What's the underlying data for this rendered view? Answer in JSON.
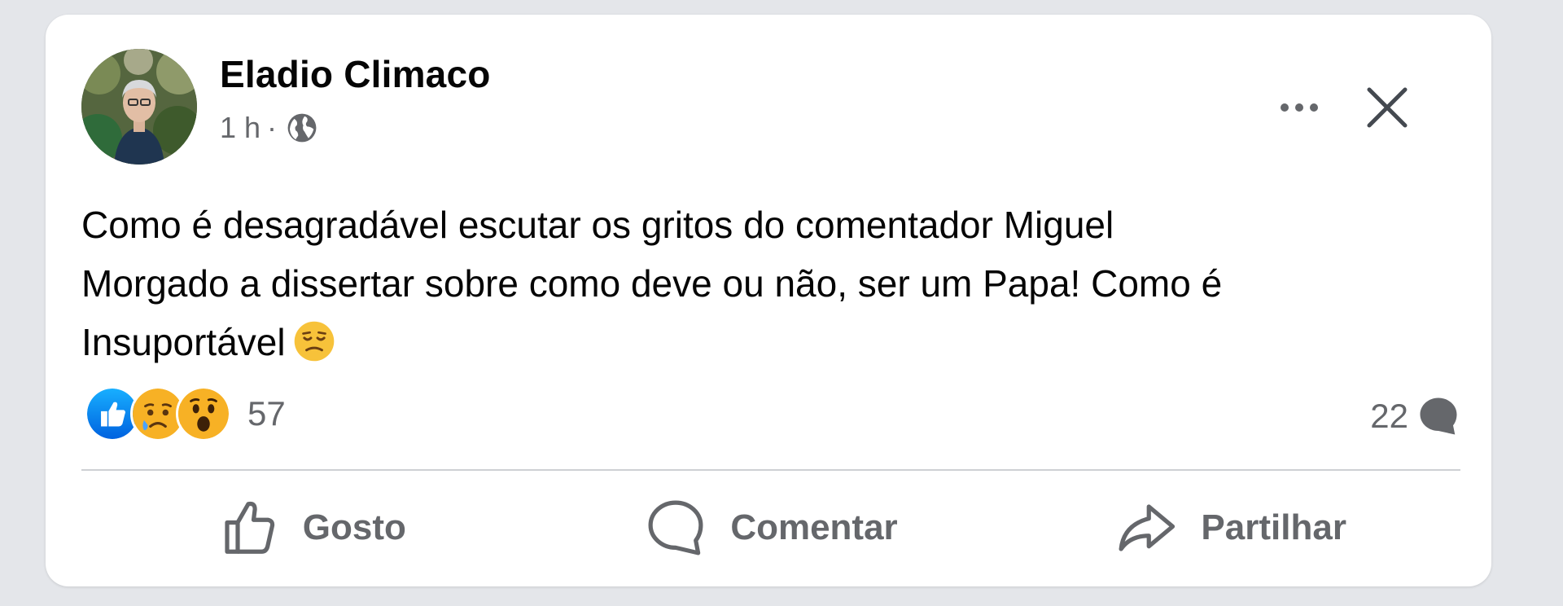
{
  "post": {
    "author": "Eladio Climaco",
    "time": "1 h",
    "separator": "·",
    "audience_icon": "globe-icon",
    "text_line1": "Como é desagradável escutar os gritos do comentador Miguel",
    "text_line2": "Morgado a dissertar sobre como deve ou não,  ser um Papa! Como é",
    "text_line3": "Insuportável",
    "inline_emoji": "weary-face-emoji",
    "reactions": [
      "like-icon",
      "sad-face-icon",
      "wow-face-icon"
    ],
    "reaction_count": "57",
    "comment_count": "22",
    "actions": {
      "like_label": "Gosto",
      "comment_label": "Comentar",
      "share_label": "Partilhar"
    }
  },
  "colors": {
    "background": "#e4e6ea",
    "card": "#ffffff",
    "text_primary": "#050505",
    "text_secondary": "#65676b",
    "like_blue": "#1877f2",
    "reaction_yellow": "#f7b125"
  }
}
